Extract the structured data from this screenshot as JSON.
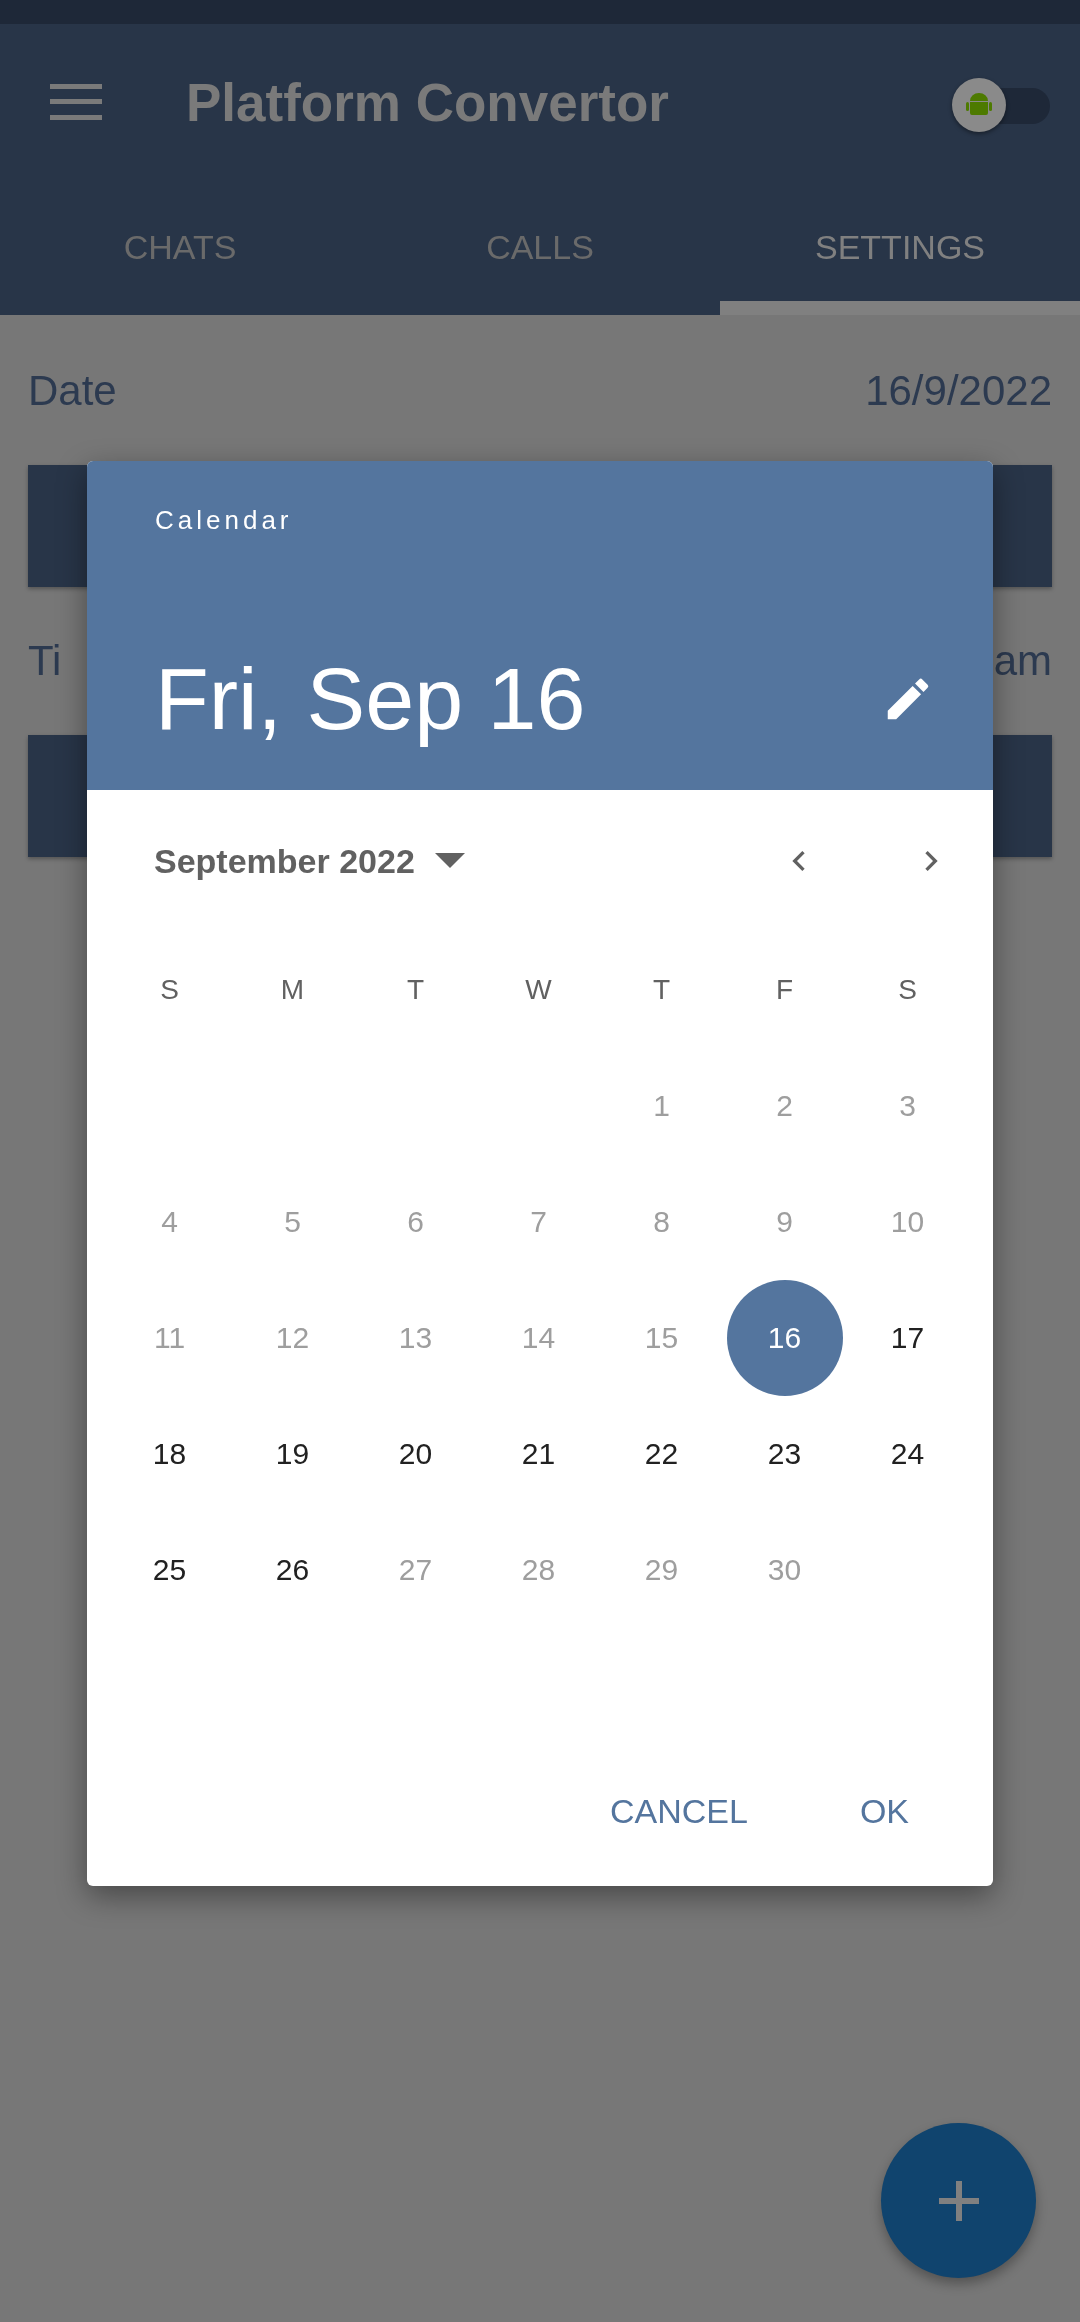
{
  "app_bar": {
    "title": "Platform Convertor",
    "platform_switch": {
      "on": false
    }
  },
  "tabs": [
    {
      "label": "CHATS",
      "selected": false
    },
    {
      "label": "CALLS",
      "selected": false
    },
    {
      "label": "SETTINGS",
      "selected": true
    }
  ],
  "settings": [
    {
      "label": "Date",
      "value": "16/9/2022"
    },
    {
      "label": "Ti",
      "value": "am"
    }
  ],
  "dialog": {
    "header_label": "Calendar",
    "selected_date": "Fri, Sep 16",
    "month": "September 2022",
    "weekdays": [
      "S",
      "M",
      "T",
      "W",
      "T",
      "F",
      "S"
    ],
    "weeks": [
      {
        "starts_midweek": true,
        "days": [
          {
            "label": "1",
            "disabled": true,
            "selected": false
          },
          {
            "label": "2",
            "disabled": true,
            "selected": false
          },
          {
            "label": "3",
            "disabled": true,
            "selected": false
          }
        ]
      },
      {
        "days": [
          {
            "label": "4",
            "disabled": true,
            "selected": false
          },
          {
            "label": "5",
            "disabled": true,
            "selected": false
          },
          {
            "label": "6",
            "disabled": true,
            "selected": false
          },
          {
            "label": "7",
            "disabled": true,
            "selected": false
          },
          {
            "label": "8",
            "disabled": true,
            "selected": false
          },
          {
            "label": "9",
            "disabled": true,
            "selected": false
          },
          {
            "label": "10",
            "disabled": true,
            "selected": false
          }
        ]
      },
      {
        "days": [
          {
            "label": "11",
            "disabled": true,
            "selected": false
          },
          {
            "label": "12",
            "disabled": true,
            "selected": false
          },
          {
            "label": "13",
            "disabled": true,
            "selected": false
          },
          {
            "label": "14",
            "disabled": true,
            "selected": false
          },
          {
            "label": "15",
            "disabled": true,
            "selected": false
          },
          {
            "label": "16",
            "disabled": false,
            "selected": true
          },
          {
            "label": "17",
            "disabled": false,
            "selected": false
          }
        ]
      },
      {
        "days": [
          {
            "label": "18",
            "disabled": false,
            "selected": false
          },
          {
            "label": "19",
            "disabled": false,
            "selected": false
          },
          {
            "label": "20",
            "disabled": false,
            "selected": false
          },
          {
            "label": "21",
            "disabled": false,
            "selected": false
          },
          {
            "label": "22",
            "disabled": false,
            "selected": false
          },
          {
            "label": "23",
            "disabled": false,
            "selected": false
          },
          {
            "label": "24",
            "disabled": false,
            "selected": false
          }
        ]
      },
      {
        "starts_midweek": false,
        "days": [
          {
            "label": "25",
            "disabled": false,
            "selected": false
          },
          {
            "label": "26",
            "disabled": false,
            "selected": false
          },
          {
            "label": "27",
            "disabled": true,
            "selected": false
          },
          {
            "label": "28",
            "disabled": true,
            "selected": false
          },
          {
            "label": "29",
            "disabled": true,
            "selected": false
          },
          {
            "label": "30",
            "disabled": true,
            "selected": false
          }
        ]
      }
    ],
    "buttons": [
      "CANCEL",
      "OK"
    ]
  }
}
